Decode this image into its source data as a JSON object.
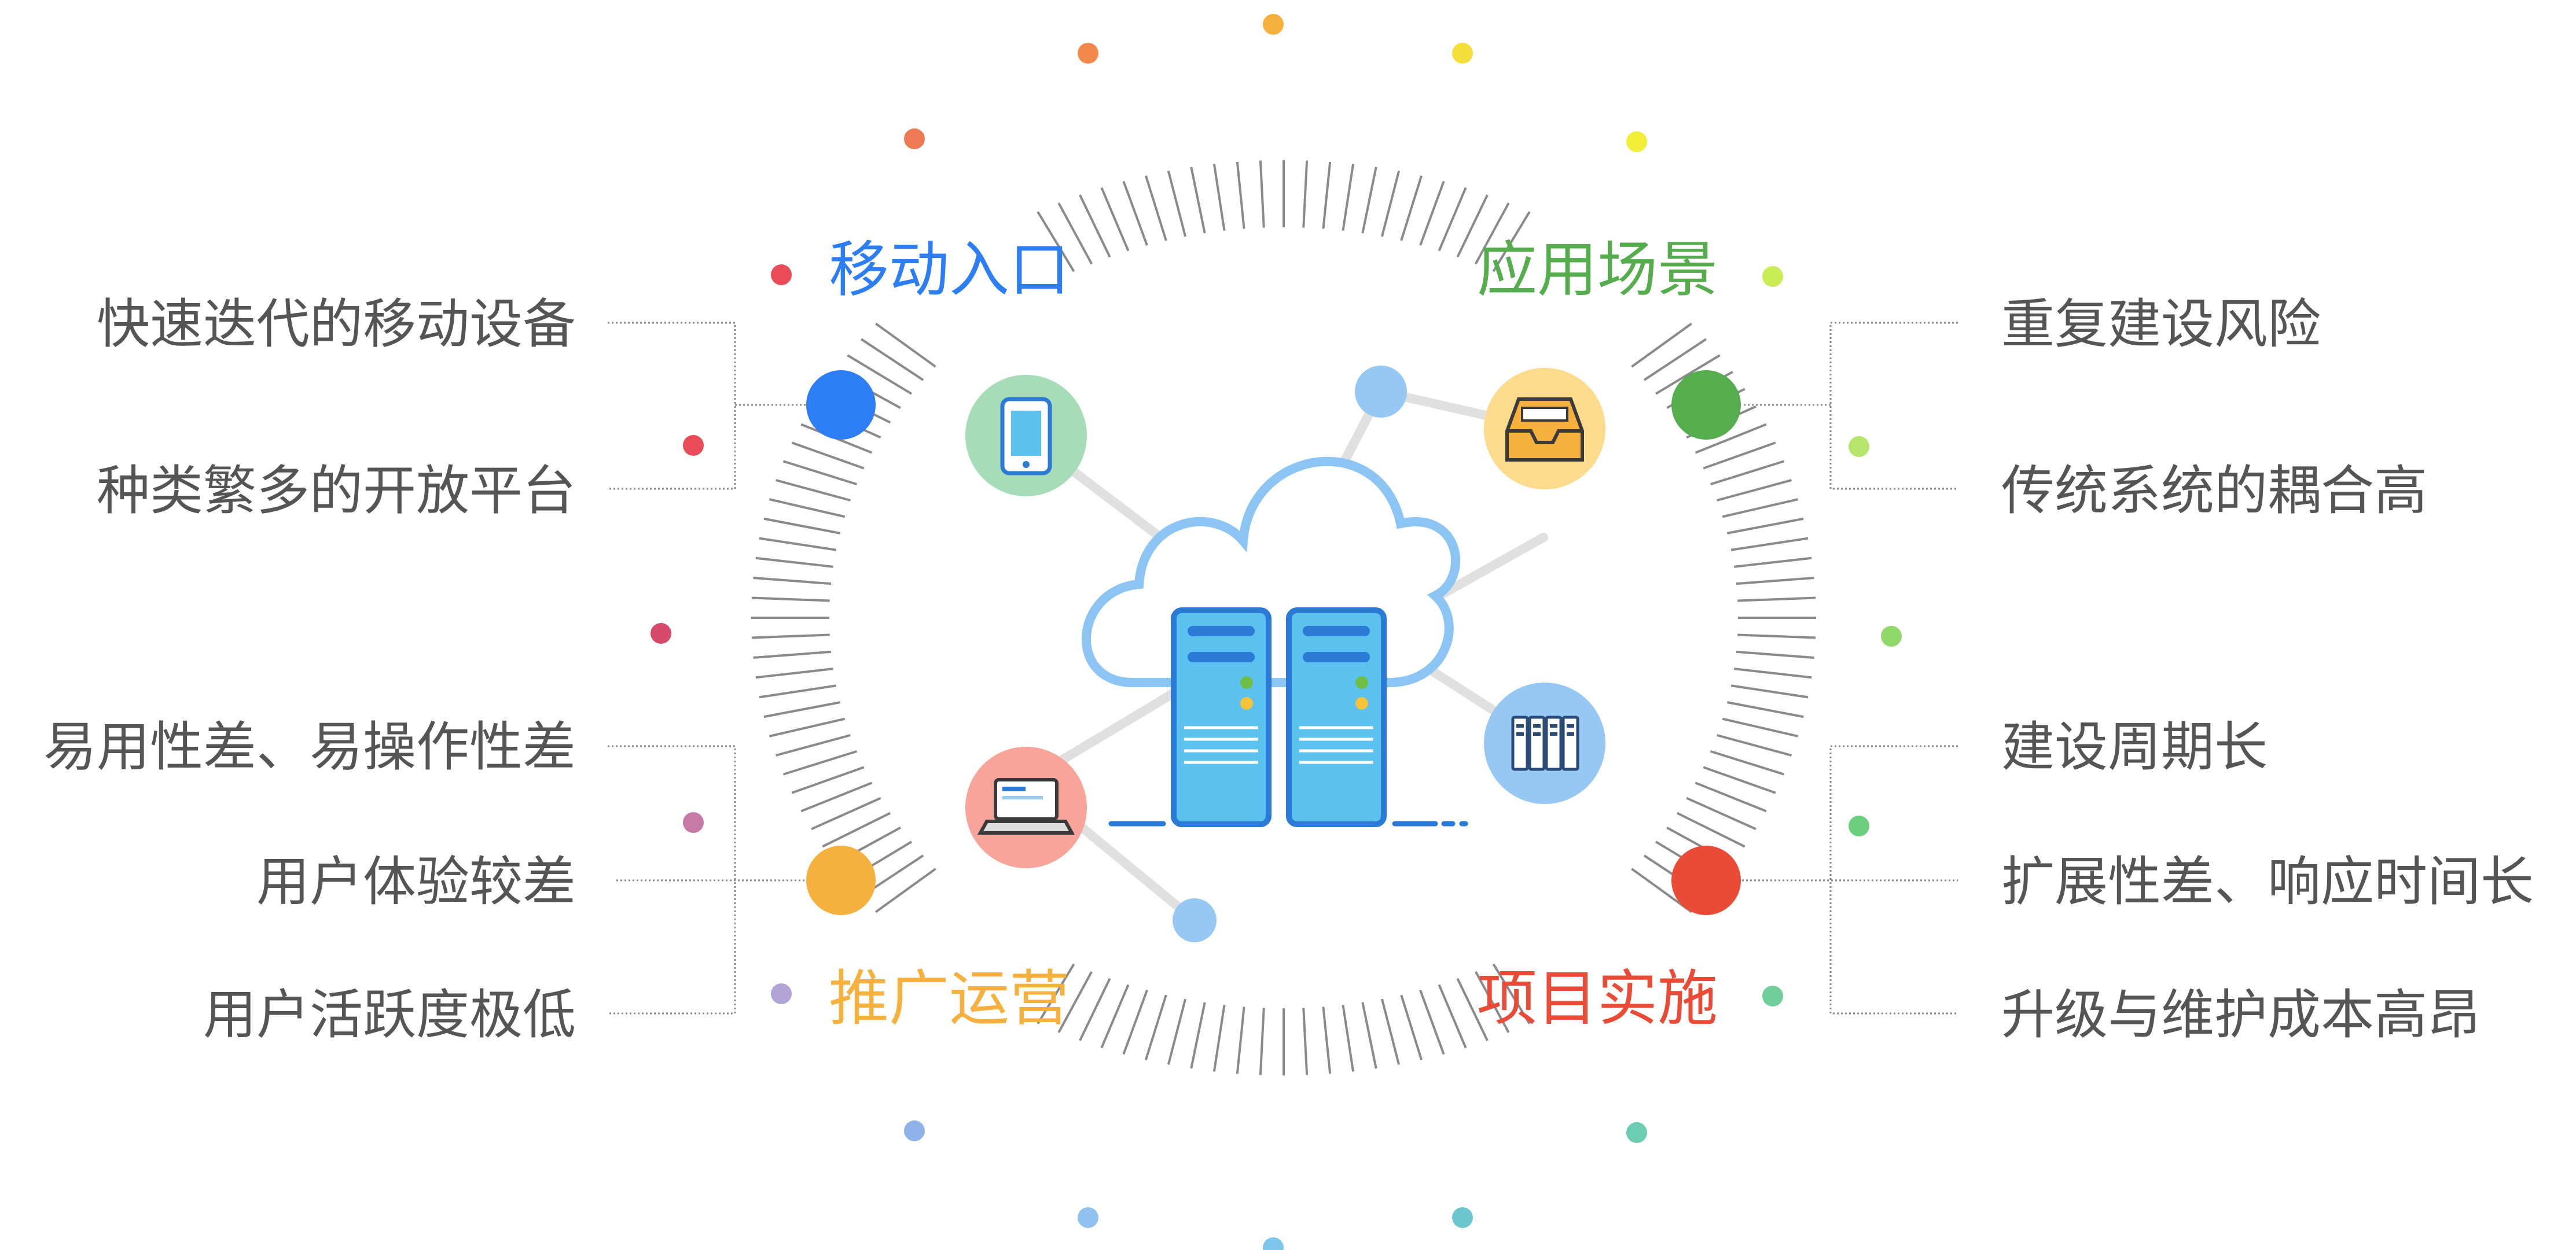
{
  "quadrants": [
    {
      "id": "mobile",
      "title": "移动入口",
      "color": "#2d7ef5",
      "points": [
        "快速迭代的移动设备",
        "种类繁多的开放平台"
      ]
    },
    {
      "id": "scene",
      "title": "应用场景",
      "color": "#55ad4d",
      "points": [
        "重复建设风险",
        "传统系统的耦合高"
      ]
    },
    {
      "id": "ops",
      "title": "推广运营",
      "color": "#f5b03e",
      "points": [
        "易用性差、易操作性差",
        "用户体验较差",
        "用户活跃度极低"
      ]
    },
    {
      "id": "impl",
      "title": "项目实施",
      "color": "#e94b36",
      "points": [
        "建设周期长",
        "扩展性差、响应时间长",
        "升级与维护成本高昂"
      ]
    }
  ],
  "icons": [
    {
      "name": "tablet-icon",
      "bg": "#a6dcb8"
    },
    {
      "name": "inbox-tray-icon",
      "bg": "#fddb8c"
    },
    {
      "name": "laptop-icon",
      "bg": "#f9a49a"
    },
    {
      "name": "server-rack-icon",
      "bg": "#96c8f3"
    }
  ],
  "colors": {
    "cloud": "#8cc4f3",
    "server": "#5bc2ef",
    "server_dark": "#2b7bd6",
    "ticks": "#8a8a8a",
    "link": "#e0e0e0",
    "text": "#555555"
  }
}
